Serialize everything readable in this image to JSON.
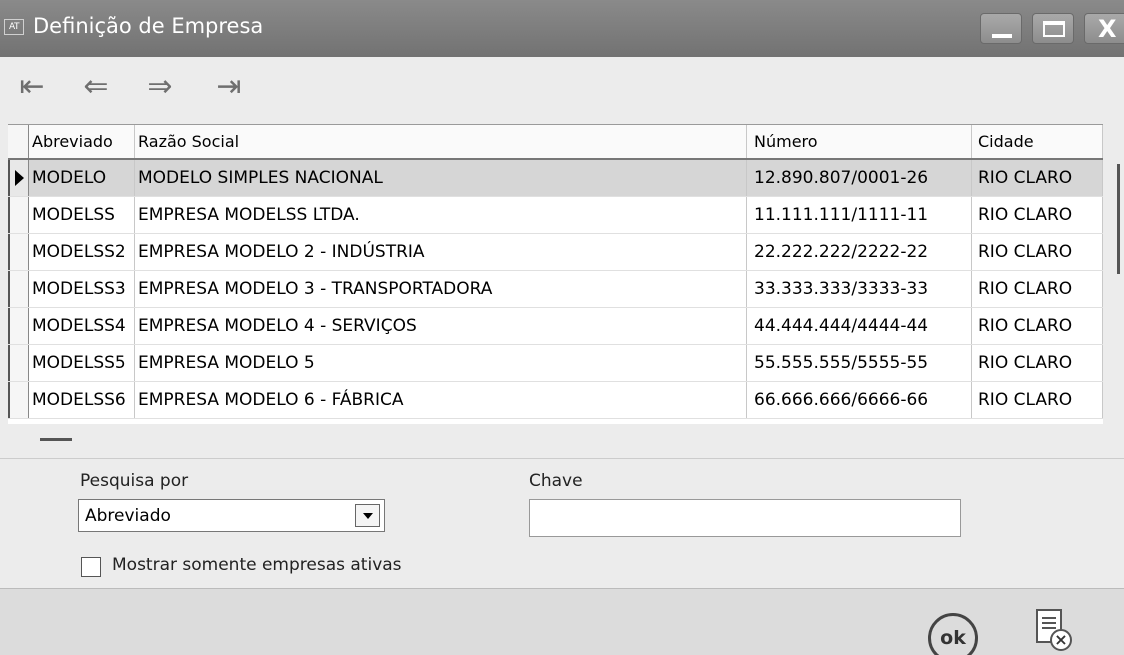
{
  "window": {
    "app_icon": "AT",
    "title": "Definição de Empresa"
  },
  "navigation": {
    "first": "⇤",
    "prev": "⇐",
    "next": "⇒",
    "last": "⇥"
  },
  "grid": {
    "columns": [
      "Abreviado",
      "Razão Social",
      "Número",
      "Cidade"
    ],
    "rows": [
      {
        "abreviado": "MODELO",
        "razao": "MODELO SIMPLES NACIONAL",
        "numero": "12.890.807/0001-26",
        "cidade": "RIO CLARO"
      },
      {
        "abreviado": "MODELSS",
        "razao": "EMPRESA MODELSS LTDA.",
        "numero": "11.111.111/1111-11",
        "cidade": "RIO CLARO"
      },
      {
        "abreviado": "MODELSS2",
        "razao": "EMPRESA MODELO 2 - INDÚSTRIA",
        "numero": "22.222.222/2222-22",
        "cidade": "RIO CLARO"
      },
      {
        "abreviado": "MODELSS3",
        "razao": "EMPRESA MODELO 3 - TRANSPORTADORA",
        "numero": "33.333.333/3333-33",
        "cidade": "RIO CLARO"
      },
      {
        "abreviado": "MODELSS4",
        "razao": "EMPRESA MODELO 4 - SERVIÇOS",
        "numero": "44.444.444/4444-44",
        "cidade": "RIO CLARO"
      },
      {
        "abreviado": "MODELSS5",
        "razao": "EMPRESA MODELO 5",
        "numero": "55.555.555/5555-55",
        "cidade": "RIO CLARO"
      },
      {
        "abreviado": "MODELSS6",
        "razao": "EMPRESA MODELO 6 - FÁBRICA",
        "numero": "66.666.666/6666-66",
        "cidade": "RIO CLARO"
      }
    ],
    "selected_index": 0
  },
  "search": {
    "search_by_label": "Pesquisa por",
    "search_by_value": "Abreviado",
    "key_label": "Chave",
    "key_value": "",
    "active_only_label": "Mostrar somente empresas ativas",
    "active_only_checked": false
  },
  "footer": {
    "ok_label": "ok"
  },
  "colors": {
    "titlebar": "#7d7d7d",
    "selected_row": "#d6d6d6"
  }
}
